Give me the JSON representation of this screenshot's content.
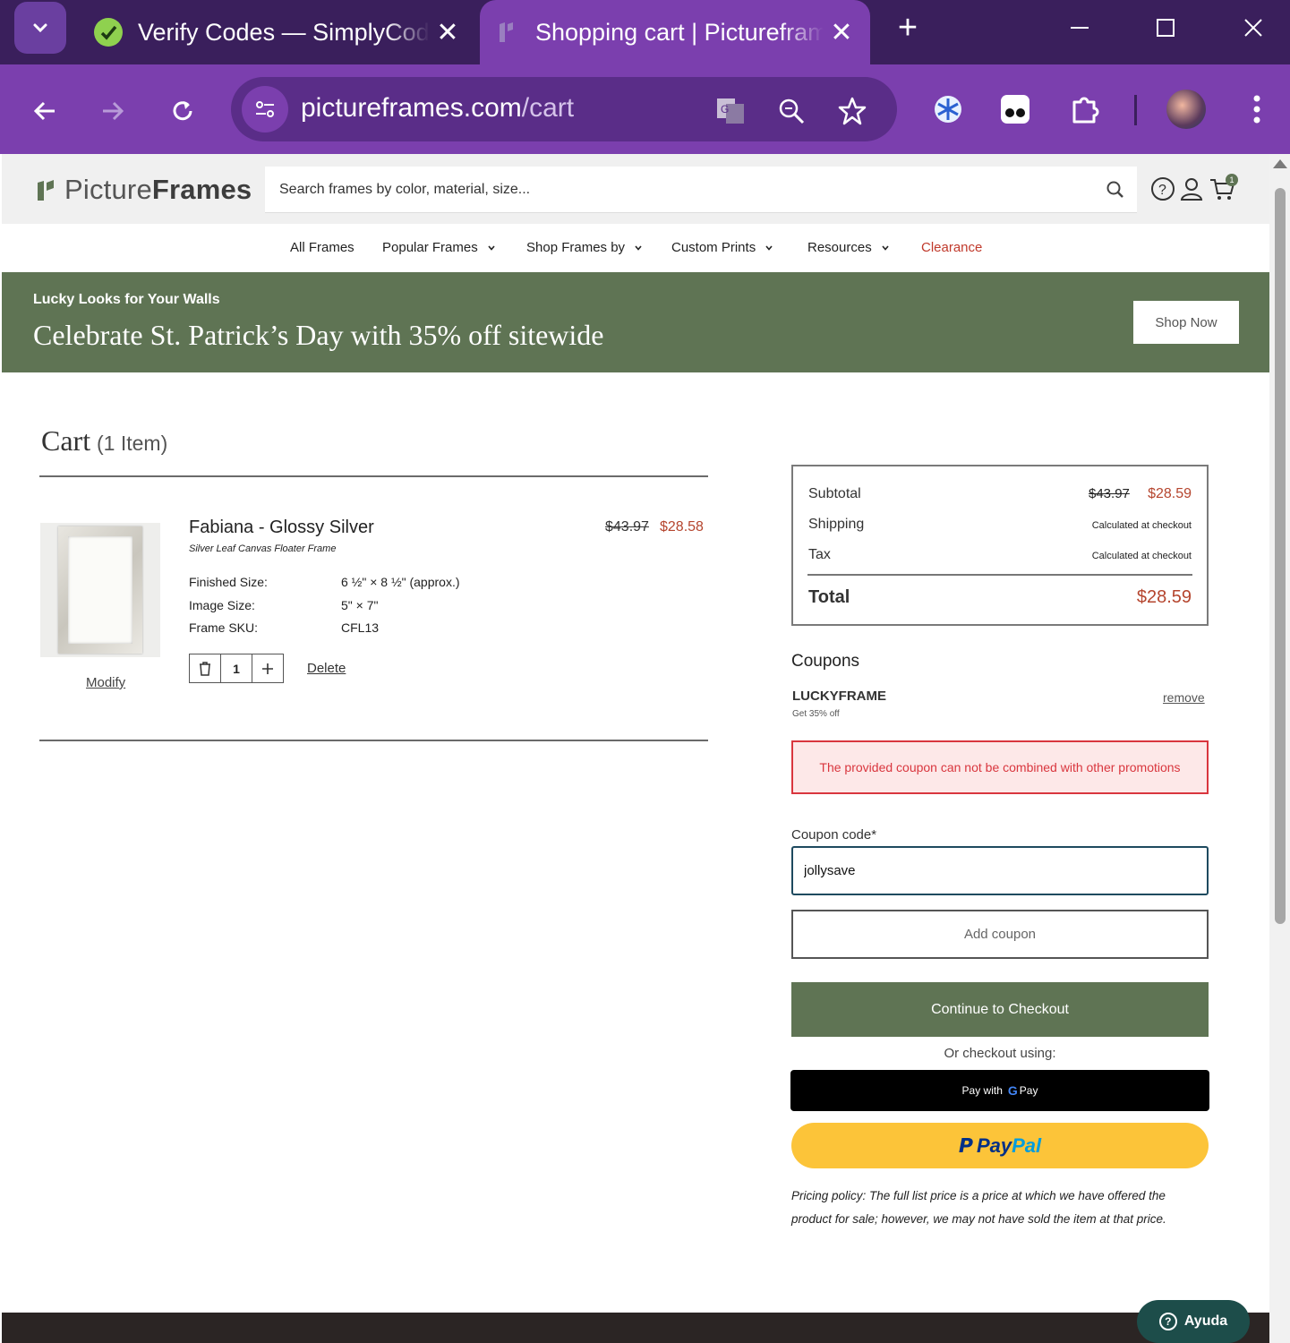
{
  "browser": {
    "tabs": [
      {
        "title": "Verify Codes — SimplyCodes",
        "active": false
      },
      {
        "title": "Shopping cart | Pictureframes.com",
        "active": true
      }
    ],
    "url_host": "pictureframes.com",
    "url_path": "/cart",
    "accent_color": "#7b3fae"
  },
  "site": {
    "logo_light": "Picture",
    "logo_bold": "Frames",
    "search_placeholder": "Search frames by color, material, size...",
    "cart_badge": "1",
    "nav": [
      "All Frames",
      "Popular Frames",
      "Shop Frames by",
      "Custom Prints",
      "Resources",
      "Clearance"
    ]
  },
  "promo": {
    "kicker": "Lucky Looks for Your Walls",
    "headline": "Celebrate St. Patrick’s Day with 35% off sitewide",
    "button": "Shop Now",
    "color": "#5f7454"
  },
  "cart": {
    "title": "Cart",
    "count_label": "(1 Item)",
    "item": {
      "name": "Fabiana - Glossy Silver",
      "subtitle": "Silver Leaf Canvas Floater Frame",
      "price_old": "$43.97",
      "price_new": "$28.58",
      "specs": [
        {
          "label": "Finished Size:",
          "value": "6 ½\" × 8 ½\" (approx.)"
        },
        {
          "label": "Image Size:",
          "value": "5\" × 7\""
        },
        {
          "label": "Frame SKU:",
          "value": "CFL13"
        }
      ],
      "quantity": "1",
      "modify": "Modify",
      "delete": "Delete"
    }
  },
  "summary": {
    "subtotal_label": "Subtotal",
    "subtotal_old": "$43.97",
    "subtotal_new": "$28.59",
    "shipping_label": "Shipping",
    "shipping_value": "Calculated at checkout",
    "tax_label": "Tax",
    "tax_value": "Calculated at checkout",
    "total_label": "Total",
    "total_value": "$28.59"
  },
  "coupons": {
    "heading": "Coupons",
    "applied_code": "LUCKYFRAME",
    "applied_desc": "Get 35% off",
    "remove": "remove",
    "error": "The provided coupon can not be combined with other promotions",
    "field_label": "Coupon code*",
    "field_value": "jollysave",
    "add_button": "Add coupon"
  },
  "checkout": {
    "continue": "Continue to Checkout",
    "or_text": "Or checkout using:",
    "gpay_prefix": "Pay with",
    "gpay_g": "G",
    "gpay_suffix": "Pay",
    "paypal_1": "Pay",
    "paypal_2": "Pal",
    "policy": "Pricing policy: The full list price is a price at which we have offered the product for sale; however, we may not have sold the item at that price."
  },
  "help": {
    "label": "Ayuda"
  }
}
